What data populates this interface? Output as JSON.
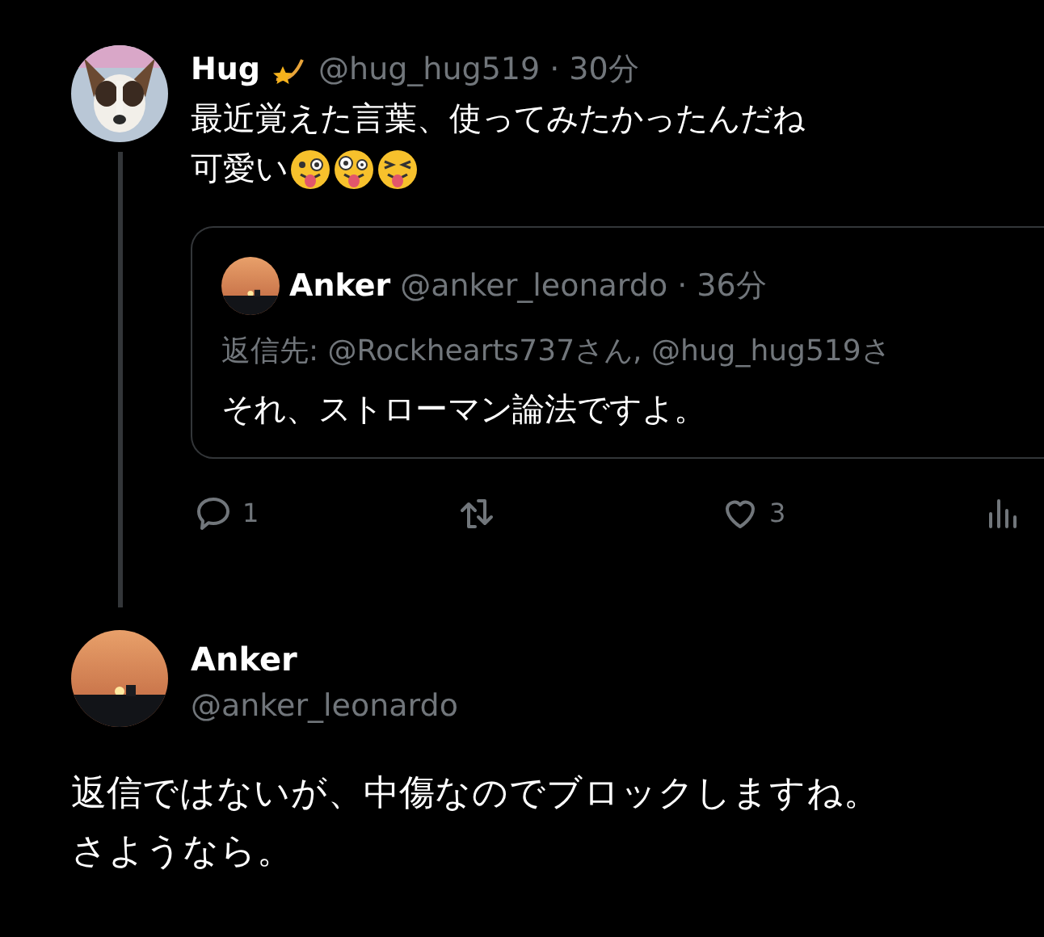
{
  "tweet": {
    "name": "Hug",
    "handle": "@hug_hug519",
    "time": "· 30分",
    "lines": [
      "最近覚えた言葉、使ってみたかったんだね",
      "可愛い"
    ],
    "quote": {
      "name": "Anker",
      "handle": "@anker_leonardo",
      "time": "· 36分",
      "reply_to": "返信先: @Rockhearts737さん, @hug_hug519さ",
      "text": "それ、ストローマン論法ですよ。"
    },
    "actions": [
      {
        "kind": "reply",
        "count": "1"
      },
      {
        "kind": "retweet"
      },
      {
        "kind": "like",
        "count": "3"
      },
      {
        "kind": "views"
      }
    ]
  },
  "reply": {
    "name": "Anker",
    "handle": "@anker_leonardo",
    "lines": [
      "返信ではないが、中傷なのでブロックしますね。",
      "さようなら。"
    ]
  }
}
